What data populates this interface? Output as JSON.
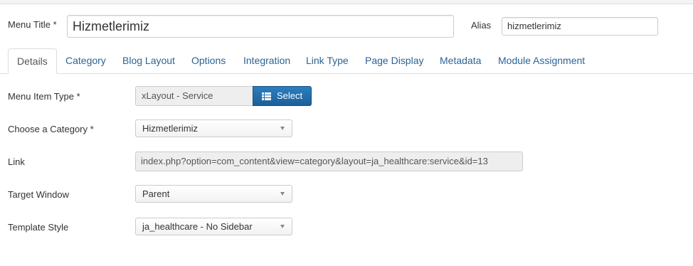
{
  "header": {
    "menu_title_label": "Menu Title *",
    "menu_title_value": "Hizmetlerimiz",
    "alias_label": "Alias",
    "alias_value": "hizmetlerimiz"
  },
  "tabs": [
    {
      "label": "Details",
      "active": true
    },
    {
      "label": "Category"
    },
    {
      "label": "Blog Layout"
    },
    {
      "label": "Options"
    },
    {
      "label": "Integration"
    },
    {
      "label": "Link Type"
    },
    {
      "label": "Page Display"
    },
    {
      "label": "Metadata"
    },
    {
      "label": "Module Assignment"
    }
  ],
  "form": {
    "menu_item_type": {
      "label": "Menu Item Type *",
      "value": "xLayout - Service",
      "button_label": "Select",
      "button_icon": "list-icon"
    },
    "category": {
      "label": "Choose a Category *",
      "value": "Hizmetlerimiz"
    },
    "link": {
      "label": "Link",
      "value": "index.php?option=com_content&view=category&layout=ja_healthcare:service&id=13"
    },
    "target_window": {
      "label": "Target Window",
      "value": "Parent"
    },
    "template_style": {
      "label": "Template Style",
      "value": "ja_healthcare - No Sidebar"
    }
  },
  "colors": {
    "accent": "#2a6496",
    "button": "#1d5f99"
  }
}
